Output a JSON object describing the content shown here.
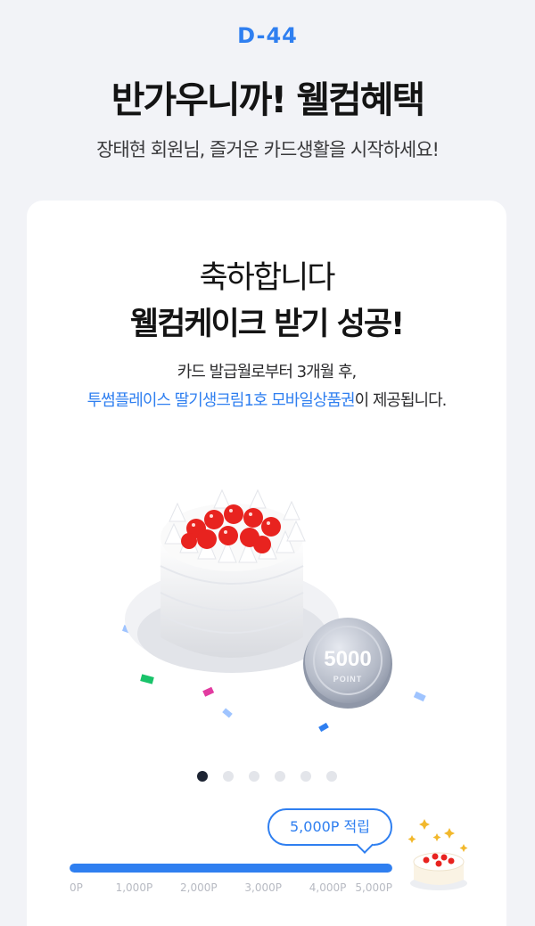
{
  "header": {
    "dday": "D-44",
    "headline": "반가우니까! 웰컴혜택",
    "subline": "장태현 회원님, 즐거운 카드생활을 시작하세요!"
  },
  "card": {
    "congrats": "축하합니다",
    "success": "웰컴케이크 받기 성공!",
    "desc_line1": "카드 발급월로부터 3개월 후,",
    "desc_line2_link": "투썸플레이스 딸기생크림1호 모바일상품권",
    "desc_line2_suffix": "이 제공됩니다.",
    "coin": {
      "value": "5000",
      "unit": "POINT"
    },
    "carousel": {
      "total": 6,
      "active_index": 0
    },
    "progress": {
      "tooltip": "5,000P 적립",
      "fraction": 1.0,
      "ticks": [
        "0P",
        "1,000P",
        "2,000P",
        "3,000P",
        "4,000P",
        "5,000P"
      ]
    }
  },
  "icons": [
    "cake-illustration",
    "point-coin-icon",
    "confetti",
    "mini-cake-icon",
    "sparkle-icon"
  ],
  "colors": {
    "accent": "#2f7ff0",
    "background": "#f2f3f7",
    "card": "#ffffff",
    "dot_active": "#1d2433"
  }
}
